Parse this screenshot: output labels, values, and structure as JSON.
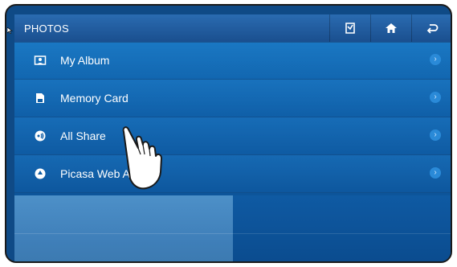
{
  "header": {
    "title": "PHOTOS",
    "buttons": [
      {
        "name": "edit-icon"
      },
      {
        "name": "home-icon"
      },
      {
        "name": "back-icon"
      }
    ]
  },
  "list": {
    "items": [
      {
        "label": "My Album",
        "icon": "album-icon"
      },
      {
        "label": "Memory Card",
        "icon": "memory-card-icon"
      },
      {
        "label": "All Share",
        "icon": "allshare-icon"
      },
      {
        "label": "Picasa Web Album",
        "icon": "picasa-icon"
      }
    ]
  },
  "colors": {
    "accent": "#1675bf",
    "topbar": "#1a4f8f",
    "text": "#ffffff"
  }
}
